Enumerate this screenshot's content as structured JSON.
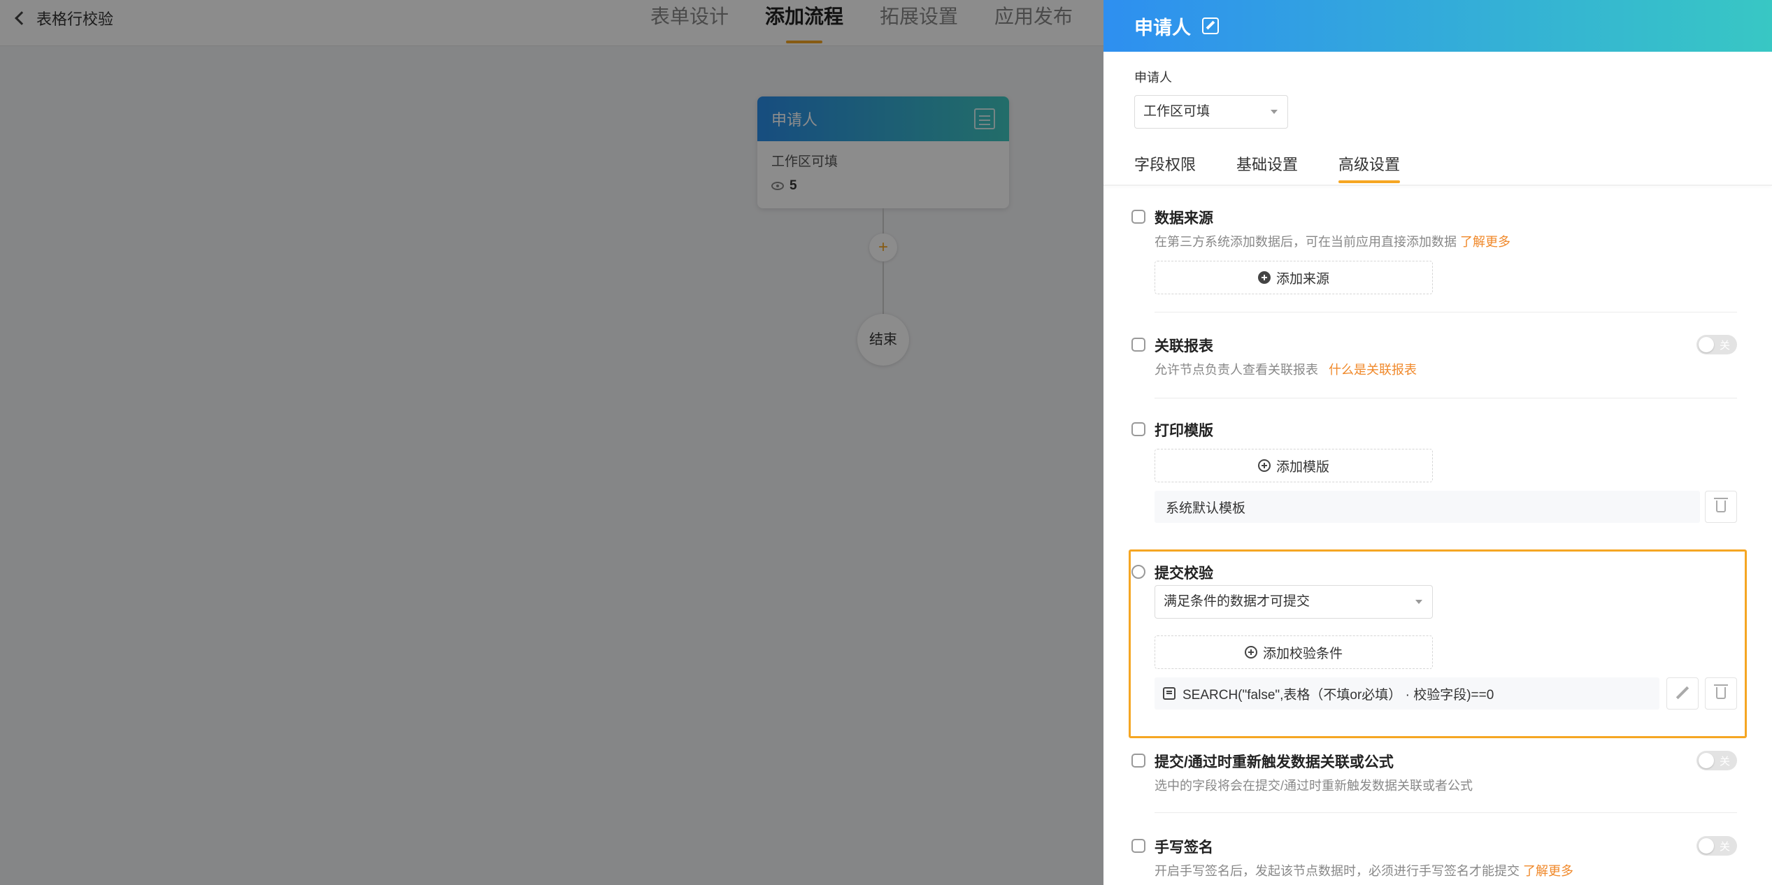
{
  "header": {
    "back_label": "表格行校验",
    "tabs": [
      {
        "label": "表单设计",
        "active": false
      },
      {
        "label": "添加流程",
        "active": true
      },
      {
        "label": "拓展设置",
        "active": false
      },
      {
        "label": "应用发布",
        "active": false
      }
    ]
  },
  "flow": {
    "node": {
      "title": "申请人",
      "subtitle": "工作区可填",
      "count": "5"
    },
    "add_symbol": "+",
    "end_label": "结束"
  },
  "drawer": {
    "title": "申请人",
    "applicant_label": "申请人",
    "applicant_select": "工作区可填",
    "tabs": [
      {
        "label": "字段权限",
        "active": false
      },
      {
        "label": "基础设置",
        "active": false
      },
      {
        "label": "高级设置",
        "active": true
      }
    ],
    "data_source": {
      "title": "数据来源",
      "desc": "在第三方系统添加数据后，可在当前应用直接添加数据",
      "link": "了解更多",
      "button": "添加来源"
    },
    "related_report": {
      "title": "关联报表",
      "desc": "允许节点负责人查看关联报表",
      "link": "什么是关联报表",
      "toggle": "关"
    },
    "print_template": {
      "title": "打印模版",
      "button": "添加模版",
      "item": "系统默认模板"
    },
    "submit_check": {
      "title": "提交校验",
      "select": "满足条件的数据才可提交",
      "button": "添加校验条件",
      "formula": "SEARCH(\"false\",表格（不填or必填） · 校验字段)==0"
    },
    "retrigger": {
      "title": "提交/通过时重新触发数据关联或公式",
      "desc": "选中的字段将会在提交/通过时重新触发数据关联或者公式",
      "toggle": "关"
    },
    "signature": {
      "title": "手写签名",
      "desc": "开启手写签名后，发起该节点数据时，必须进行手写签名才能提交",
      "link": "了解更多",
      "toggle": "关"
    }
  },
  "colors": {
    "accent": "#f5a623",
    "link": "#f0892b",
    "header_gradient_start": "#2e8ff0",
    "header_gradient_end": "#38c7c4"
  }
}
